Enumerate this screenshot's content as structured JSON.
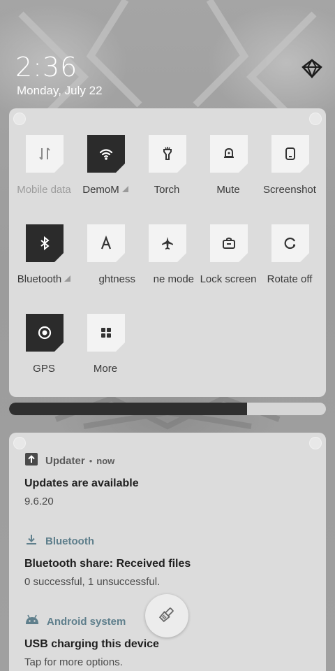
{
  "lockscreen": {
    "time": "2:36",
    "date": "Monday, July 22"
  },
  "quick_settings": {
    "tiles": [
      {
        "label": "Mobile data",
        "icon": "mobile-data-icon",
        "state": "unavailable"
      },
      {
        "label": "DemoM",
        "icon": "wifi-icon",
        "state": "on"
      },
      {
        "label": "Torch",
        "icon": "torch-icon",
        "state": "off"
      },
      {
        "label": "Mute",
        "icon": "mute-bell-icon",
        "state": "off"
      },
      {
        "label": "Screenshot",
        "icon": "screenshot-icon",
        "state": "off"
      },
      {
        "label": "Bluetooth",
        "icon": "bluetooth-icon",
        "state": "on"
      },
      {
        "label": "ghtness",
        "icon": "auto-brightness-icon",
        "state": "off"
      },
      {
        "label": "ne mode",
        "icon": "airplane-icon",
        "state": "off"
      },
      {
        "label": "Lock screen",
        "icon": "lock-screen-icon",
        "state": "off"
      },
      {
        "label": "Rotate off",
        "icon": "rotate-icon",
        "state": "off"
      },
      {
        "label": "GPS",
        "icon": "gps-icon",
        "state": "on"
      },
      {
        "label": "More",
        "icon": "more-grid-icon",
        "state": "off"
      }
    ],
    "brightness_level": 0.75
  },
  "notifications": [
    {
      "app": "Updater",
      "time": "now",
      "title": "Updates are available",
      "text": "9.6.20",
      "icon": "upload-arrow-icon"
    },
    {
      "app": "Bluetooth",
      "title": "Bluetooth share: Received files",
      "text": "0 successful, 1 unsuccessful.",
      "icon": "download-icon"
    },
    {
      "app": "Android system",
      "title": "USB charging this device",
      "text": "Tap for more options.",
      "icon": "android-icon"
    }
  ],
  "actions": {
    "clear_all_icon": "broom-icon"
  },
  "colors": {
    "panel_bg": "#dcdcdc",
    "tile_on": "#2b2b2b",
    "tile_off": "#f3f3f3",
    "link_blue_gray": "#5f7f8c"
  }
}
